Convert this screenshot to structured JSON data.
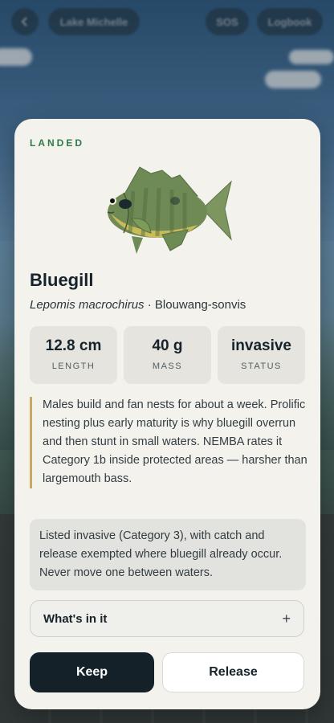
{
  "topbar": {
    "location": "Lake Michelle",
    "sos_label": "SOS",
    "logbook_label": "Logbook"
  },
  "card": {
    "eyebrow": "LANDED",
    "species_name": "Bluegill",
    "scientific_name": "Lepomis macrochirus",
    "separator": " · ",
    "local_name": "Blouwang-sonvis",
    "stats": [
      {
        "value": "12.8 cm",
        "label": "LENGTH"
      },
      {
        "value": "40 g",
        "label": "MASS"
      },
      {
        "value": "invasive",
        "label": "STATUS"
      }
    ],
    "note": "Males build and fan nests for about a week. Prolific nesting plus early maturity is why bluegill overrun and then stunt in small waters. NEMBA rates it Category 1b inside protected areas — harsher than largemouth bass.",
    "regulation": "Listed invasive (Category 3), with catch and release exempted where bluegill already occur. Never move one between waters.",
    "accordion_title": "What's in it",
    "accordion_icon": "plus-icon",
    "keep_label": "Keep",
    "release_label": "Release"
  },
  "colors": {
    "accent_green": "#2f7a47",
    "note_border": "#c9ab5f",
    "primary_button": "#142129",
    "card_bg": "#f3f2ed"
  }
}
